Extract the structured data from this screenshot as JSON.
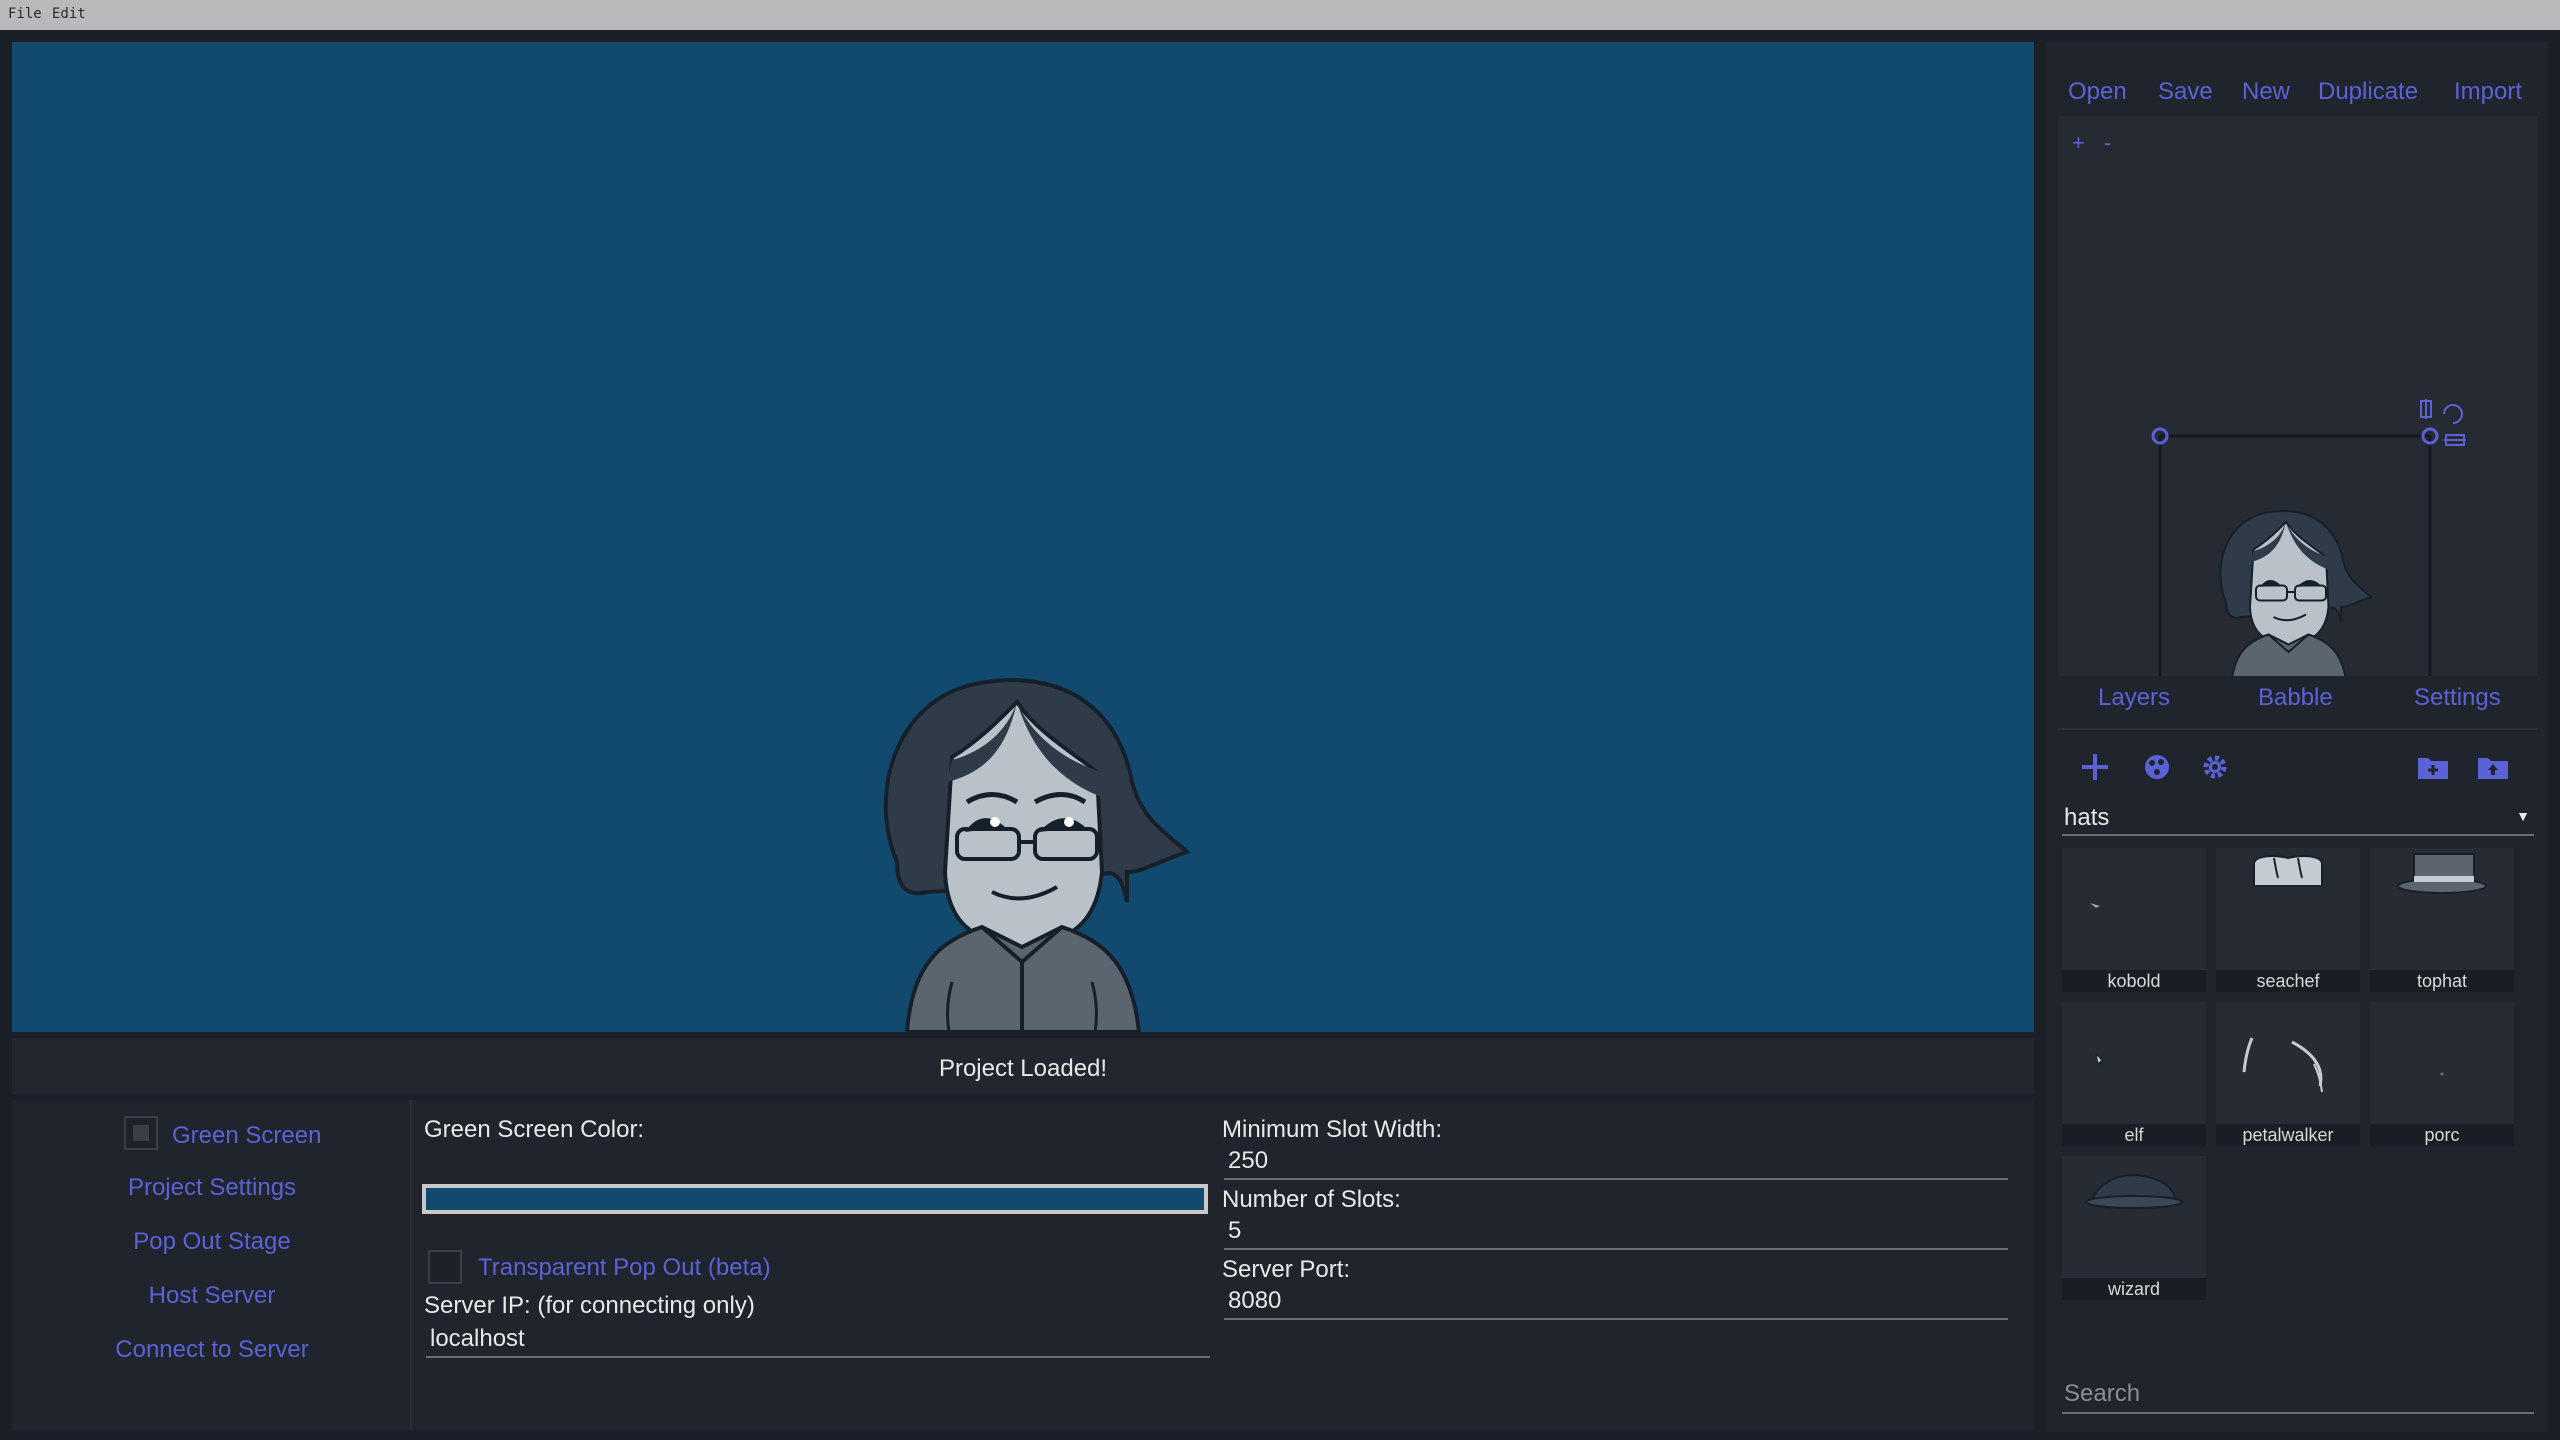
{
  "menu": {
    "file": "File",
    "edit": "Edit"
  },
  "status": "Project Loaded!",
  "left_menu": {
    "green_screen": "Green Screen",
    "green_screen_checked": true,
    "project_settings": "Project Settings",
    "pop_out_stage": "Pop Out Stage",
    "host_server": "Host Server",
    "connect_to_server": "Connect to Server"
  },
  "settings": {
    "green_screen_color_label": "Green Screen Color:",
    "green_screen_color": "#114a6e",
    "transparent_pop_out": "Transparent Pop Out (beta)",
    "transparent_pop_out_checked": false,
    "server_ip_label": "Server IP: (for connecting only)",
    "server_ip": "localhost",
    "min_slot_width_label": "Minimum Slot Width:",
    "min_slot_width": "250",
    "num_slots_label": "Number of Slots:",
    "num_slots": "5",
    "server_port_label": "Server Port:",
    "server_port": "8080"
  },
  "file_actions": {
    "open": "Open",
    "save": "Save",
    "new": "New",
    "duplicate": "Duplicate",
    "import": "Import"
  },
  "zoom": {
    "in": "+",
    "out": "-"
  },
  "tabs": {
    "layers": "Layers",
    "babble": "Babble",
    "settings": "Settings"
  },
  "category": "hats",
  "assets": [
    {
      "name": "kobold"
    },
    {
      "name": "seachef"
    },
    {
      "name": "tophat"
    },
    {
      "name": "elf"
    },
    {
      "name": "petalwalker"
    },
    {
      "name": "porc"
    },
    {
      "name": "wizard"
    }
  ],
  "search_placeholder": "Search",
  "colors": {
    "stage_bg": "#114a6e",
    "accent": "#5a62d6",
    "panel": "#20242c"
  }
}
